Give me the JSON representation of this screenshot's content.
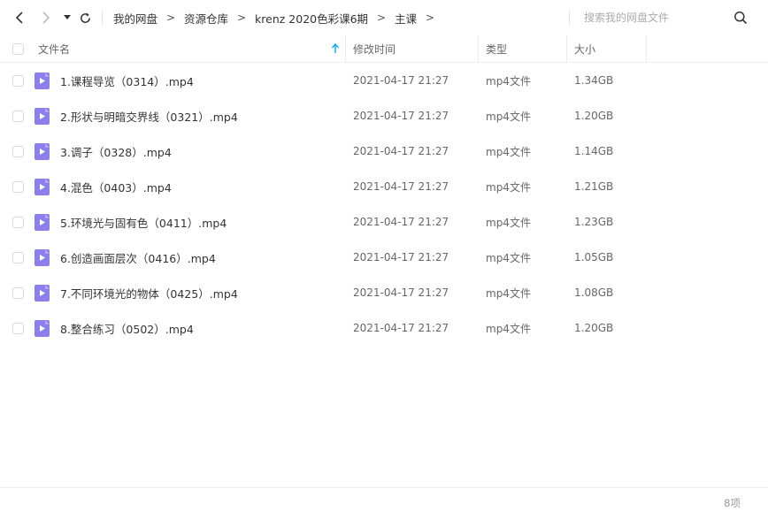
{
  "nav": {
    "back_icon": "chevron-left-icon",
    "forward_icon": "chevron-right-icon",
    "history_icon": "caret-down-icon",
    "refresh_icon": "refresh-icon"
  },
  "breadcrumb": {
    "items": [
      "我的网盘",
      "资源仓库",
      "krenz 2020色彩课6期",
      "主课"
    ],
    "separator": ">"
  },
  "search": {
    "placeholder": "搜索我的网盘文件"
  },
  "columns": {
    "name": "文件名",
    "modified": "修改时间",
    "type": "类型",
    "size": "大小"
  },
  "files": [
    {
      "name": "1.课程导览（0314）.mp4",
      "modified": "2021-04-17 21:27",
      "type": "mp4文件",
      "size": "1.34GB"
    },
    {
      "name": "2.形状与明暗交界线（0321）.mp4",
      "modified": "2021-04-17 21:27",
      "type": "mp4文件",
      "size": "1.20GB"
    },
    {
      "name": "3.调子（0328）.mp4",
      "modified": "2021-04-17 21:27",
      "type": "mp4文件",
      "size": "1.14GB"
    },
    {
      "name": "4.混色（0403）.mp4",
      "modified": "2021-04-17 21:27",
      "type": "mp4文件",
      "size": "1.21GB"
    },
    {
      "name": "5.环境光与固有色（0411）.mp4",
      "modified": "2021-04-17 21:27",
      "type": "mp4文件",
      "size": "1.23GB"
    },
    {
      "name": "6.创造画面层次（0416）.mp4",
      "modified": "2021-04-17 21:27",
      "type": "mp4文件",
      "size": "1.05GB"
    },
    {
      "name": "7.不同环境光的物体（0425）.mp4",
      "modified": "2021-04-17 21:27",
      "type": "mp4文件",
      "size": "1.08GB"
    },
    {
      "name": "8.整合练习（0502）.mp4",
      "modified": "2021-04-17 21:27",
      "type": "mp4文件",
      "size": "1.20GB"
    }
  ],
  "footer": {
    "count": "8项"
  },
  "colors": {
    "accent": "#06a7ff",
    "file_icon": "#8b7ff0",
    "text": "#333333",
    "muted": "#666666"
  }
}
